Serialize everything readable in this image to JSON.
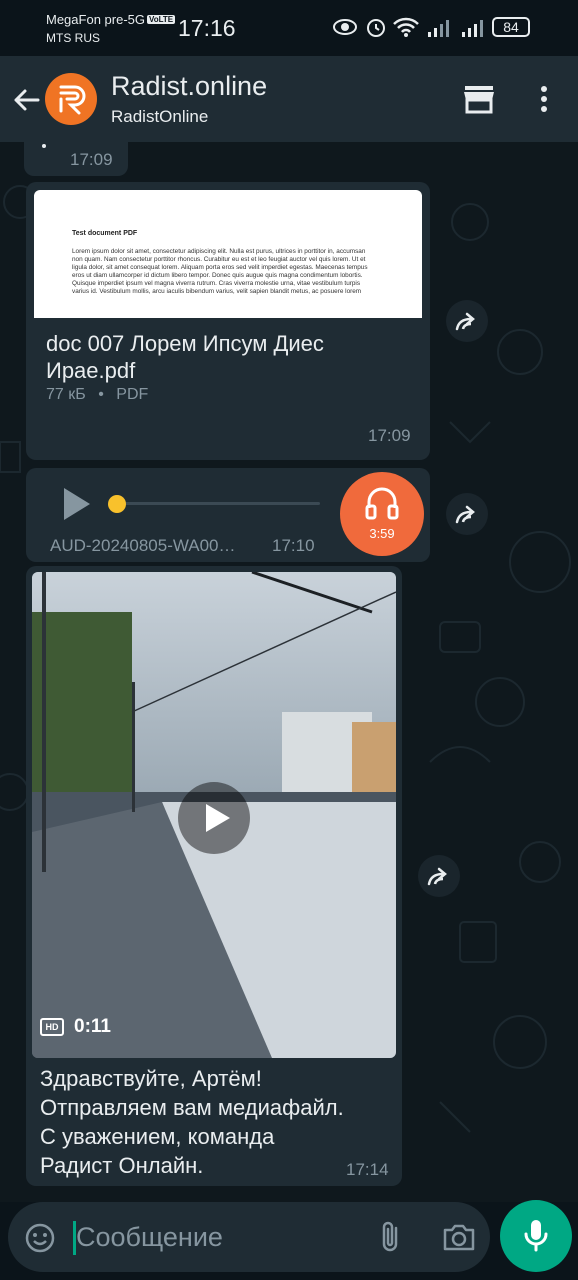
{
  "status_bar": {
    "carrier1": "MegaFon pre-5G",
    "volte": "VoLTE",
    "carrier2": "MTS RUS",
    "time": "17:16",
    "battery": "84"
  },
  "header": {
    "title": "Radist.online",
    "subtitle": "RadistOnline"
  },
  "messages": {
    "prev_time": "17:09",
    "document": {
      "preview_title": "Test document PDF",
      "preview_text": "Lorem ipsum dolor sit amet, consectetur adipiscing elit. Nulla est purus, ultrices in porttitor in, accumsan non quam. Nam consectetur porttitor rhoncus. Curabitur eu est et leo feugiat auctor vel quis lorem. Ut et ligula dolor, sit amet consequat lorem. Aliquam porta eros sed velit imperdiet egestas. Maecenas tempus eros ut diam ullamcorper id dictum libero tempor. Donec quis augue quis magna condimentum lobortis. Quisque imperdiet ipsum vel magna viverra rutrum. Cras viverra molestie urna, vitae vestibulum turpis varius id. Vestibulum mollis, arcu iaculis bibendum varius, velit sapien blandit metus, ac posuere lorem",
      "name": "doc 007 Лорем Ипсум Диес Ирае.pdf",
      "size": "77 кБ",
      "sep": "•",
      "type": "PDF",
      "time": "17:09"
    },
    "audio": {
      "name": "AUD-20240805-WA00…",
      "time": "17:10",
      "duration": "3:59",
      "progress": 0.0
    },
    "video": {
      "hd": "HD",
      "duration": "0:11",
      "caption": [
        "Здравствуйте, Артём!",
        "Отправляем вам медиафайл.",
        "С уважением, команда",
        "Радист Онлайн."
      ],
      "time": "17:14"
    }
  },
  "input": {
    "placeholder": "Сообщение"
  },
  "colors": {
    "accent": "#00a884",
    "avatar": "#f07424",
    "audio_badge": "#f06a3c",
    "bubble": "#1f2c34"
  },
  "icons": [
    "back-arrow-icon",
    "store-icon",
    "more-vert-icon",
    "forward-icon",
    "play-icon",
    "headphones-icon",
    "hd-icon",
    "emoji-icon",
    "attach-icon",
    "camera-icon",
    "mic-icon"
  ]
}
